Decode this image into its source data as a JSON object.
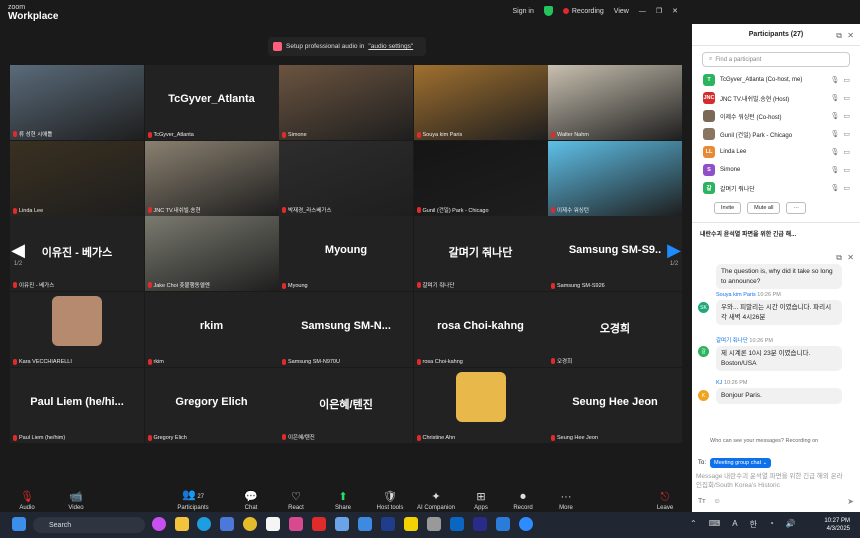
{
  "app": {
    "brand_line1": "zoom",
    "brand_line2": "Workplace",
    "signin": "Sign in",
    "recording": "Recording",
    "view": "View"
  },
  "banner": {
    "text": "Setup professional audio in",
    "link": "\"audio settings\""
  },
  "tiles": [
    {
      "name": "",
      "tag": "류 성현 시애틀"
    },
    {
      "name": "TcGyver_Atlanta",
      "tag": "TcGyver_Atlanta"
    },
    {
      "name": "",
      "tag": "Simone"
    },
    {
      "name": "",
      "tag": "Souya kim Paris"
    },
    {
      "name": "",
      "tag": "Walter Nahm"
    },
    {
      "name": "",
      "tag": "Linda Lee"
    },
    {
      "name": "",
      "tag": "JNC TV.내쉬빌.송현"
    },
    {
      "name": "",
      "tag": "박재경_라스베가스"
    },
    {
      "name": "",
      "tag": "Gunil (건일) Park - Chicago"
    },
    {
      "name": "",
      "tag": "이제수 워싱턴"
    },
    {
      "name": "이유진 - 베가스",
      "tag": "이유진 - 베가스"
    },
    {
      "name": "",
      "tag": "Jake Choi 촛불행동엘엔"
    },
    {
      "name": "Myoung",
      "tag": "Myoung"
    },
    {
      "name": "갈며기 줘나단",
      "tag": "갈며기 줘나단"
    },
    {
      "name": "Samsung SM-S9..",
      "tag": "Samsung SM-S926"
    },
    {
      "name": "",
      "tag": "Kara VECCHIARELLI"
    },
    {
      "name": "rkim",
      "tag": "rkim"
    },
    {
      "name": "Samsung SM-N...",
      "tag": "Samsung SM-N970U"
    },
    {
      "name": "rosa Choi-kahng",
      "tag": "rosa Choi-kahng"
    },
    {
      "name": "오경희",
      "tag": "오경희"
    },
    {
      "name": "Paul Liem (he/hi...",
      "tag": "Paul Liem (he/him)"
    },
    {
      "name": "Gregory Elich",
      "tag": "Gregory Elich"
    },
    {
      "name": "이은혜/텐진",
      "tag": "이은혜/텐진"
    },
    {
      "name": "",
      "tag": "Christine Ahn"
    },
    {
      "name": "Seung Hee Jeon",
      "tag": "Seung Hee Jeon"
    }
  ],
  "paging": {
    "left": "1/2",
    "right": "1/2"
  },
  "participants": {
    "title": "Participants (27)",
    "search_placeholder": "Find a participant",
    "list": [
      {
        "initial": "T",
        "color": "#2bb35f",
        "name": "TcGyver_Atlanta (Co-host, me)"
      },
      {
        "initial": "JNC",
        "color": "#d62b2b",
        "name": "JNC TV.내쉬빌.송현 (Host)"
      },
      {
        "initial": "",
        "color": "#7a6a55",
        "name": "이제수 워싱턴 (Co-host)"
      },
      {
        "initial": "",
        "color": "#8a7560",
        "name": "Gunil (건일) Park - Chicago"
      },
      {
        "initial": "LL",
        "color": "#e88a35",
        "name": "Linda Lee"
      },
      {
        "initial": "S",
        "color": "#8e4fc9",
        "name": "Simone"
      },
      {
        "initial": "갈",
        "color": "#2bb35f",
        "name": "갈며기 줘나단"
      }
    ],
    "invite": "Invite",
    "mute_all": "Mute all",
    "more": "···"
  },
  "chat": {
    "title": "내란수괴 윤석열 파면을 위한 긴급 해...",
    "messages": [
      {
        "who": "",
        "time": "",
        "text": "The question is, why did it take so long to announce?"
      },
      {
        "who": "Souya kim Paris",
        "time": "10:26 PM",
        "initial": "SK",
        "color": "#1fa87a",
        "text": "우와... 피말리는 시간 이였습니다. 파리시각 새벽 4시26분"
      },
      {
        "who": "갈며기 줘나단",
        "time": "10:26 PM",
        "initial": "갈",
        "color": "#2bb35f",
        "text": "제 시계론 10시 23분 이였습니다. Boston/USA"
      },
      {
        "who": "KJ",
        "time": "10:26 PM",
        "initial": "K",
        "color": "#f0a31e",
        "text": "Bonjour Paris."
      }
    ],
    "visibility": "Who can see your messages? Recording on",
    "to": "To:",
    "to_target": "Meeting group chat ⌄",
    "input": "Message 내란수괴 윤석열 파면을 위한 긴급 해외 온라인집회/South Korea's Historic"
  },
  "toolbar": [
    {
      "label": "Audio",
      "glyph": "🎙"
    },
    {
      "label": "Video",
      "glyph": "📹"
    },
    {
      "label": "Participants",
      "glyph": "👥",
      "count": "27"
    },
    {
      "label": "Chat",
      "glyph": "💬"
    },
    {
      "label": "React",
      "glyph": "♡"
    },
    {
      "label": "Share",
      "glyph": "⬆"
    },
    {
      "label": "Host tools",
      "glyph": "🛡"
    },
    {
      "label": "AI Companion",
      "glyph": "✦"
    },
    {
      "label": "Apps",
      "glyph": "⊞"
    },
    {
      "label": "Record",
      "glyph": "⏺"
    },
    {
      "label": "More",
      "glyph": "···"
    },
    {
      "label": "Leave",
      "glyph": "⎋"
    }
  ],
  "taskbar": {
    "search": "Search",
    "time": "10:27 PM",
    "date": "4/3/2025"
  }
}
